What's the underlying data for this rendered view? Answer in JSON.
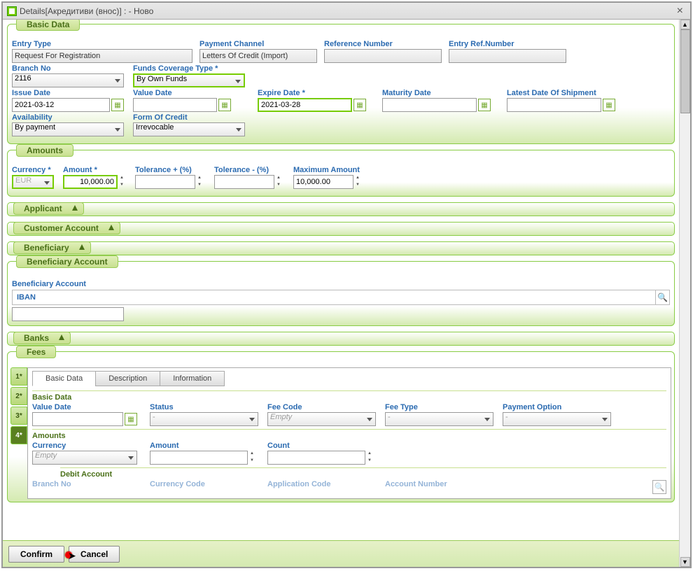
{
  "window": {
    "title": "Details[Акредитиви (внос)] :               - Ново"
  },
  "legends": {
    "basic": "Basic Data",
    "amounts": "Amounts",
    "applicant": "Applicant",
    "custacct": "Customer Account",
    "beneficiary": "Beneficiary",
    "benacct": "Beneficiary Account",
    "banks": "Banks",
    "fees": "Fees"
  },
  "basic": {
    "entryType": {
      "label": "Entry Type",
      "value": "Request For Registration"
    },
    "paymentChannel": {
      "label": "Payment Channel",
      "value": "Letters Of Credit (Import)"
    },
    "refNum": {
      "label": "Reference Number",
      "value": ""
    },
    "entryRef": {
      "label": "Entry Ref.Number",
      "value": ""
    },
    "branch": {
      "label": "Branch No",
      "value": "2116"
    },
    "fundsType": {
      "label": "Funds Coverage Type *",
      "value": "By Own Funds"
    },
    "issueDate": {
      "label": "Issue Date",
      "value": "2021-03-12"
    },
    "valueDate": {
      "label": "Value Date",
      "value": ""
    },
    "expireDate": {
      "label": "Expire Date *",
      "value": "2021-03-28"
    },
    "maturityDate": {
      "label": "Maturity Date",
      "value": ""
    },
    "shipDate": {
      "label": "Latest Date Of Shipment",
      "value": ""
    },
    "availability": {
      "label": "Availability",
      "value": "By payment"
    },
    "formCredit": {
      "label": "Form Of Credit",
      "value": "Irrevocable"
    }
  },
  "amounts": {
    "currency": {
      "label": "Currency *",
      "value": "EUR"
    },
    "amount": {
      "label": "Amount *",
      "value": "10,000.00"
    },
    "tolPlus": {
      "label": "Tolerance + (%)",
      "value": ""
    },
    "tolMinus": {
      "label": "Tolerance - (%)",
      "value": ""
    },
    "maxAmt": {
      "label": "Maximum Amount",
      "value": "10,000.00"
    }
  },
  "benAcct": {
    "label": "Beneficiary Account",
    "iban": "IBAN",
    "value": ""
  },
  "fees": {
    "sideTabs": [
      "1*",
      "2*",
      "3*",
      "4*"
    ],
    "tabs": {
      "basic": "Basic Data",
      "desc": "Description",
      "info": "Information"
    },
    "hdrBasic": "Basic Data",
    "valueDate": {
      "label": "Value Date",
      "value": ""
    },
    "status": {
      "label": "Status",
      "value": "-"
    },
    "feeCode": {
      "label": "Fee Code",
      "value": "Empty"
    },
    "feeType": {
      "label": "Fee Type",
      "value": "-"
    },
    "payOpt": {
      "label": "Payment Option",
      "value": "-"
    },
    "hdrAmounts": "Amounts",
    "currency": {
      "label": "Currency",
      "value": "Empty"
    },
    "amount": {
      "label": "Amount",
      "value": ""
    },
    "count": {
      "label": "Count",
      "value": ""
    },
    "debitAcct": "Debit Account",
    "cut": {
      "branch": "Branch No",
      "currCode": "Currency Code",
      "appCode": "Application Code",
      "acctNum": "Account Number"
    }
  },
  "footer": {
    "confirm": "Confirm",
    "cancel": "Cancel"
  }
}
